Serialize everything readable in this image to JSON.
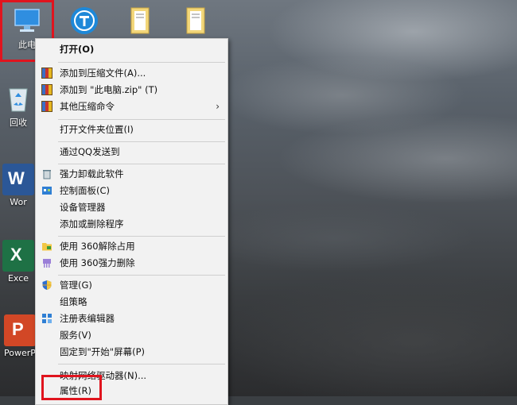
{
  "desktop": {
    "icons": [
      {
        "label": "此电",
        "name": "this-pc"
      },
      {
        "label": "回收",
        "name": "recycle-bin"
      },
      {
        "label": "Wor",
        "name": "word"
      },
      {
        "label": "Exce",
        "name": "excel"
      },
      {
        "label": "PowerP",
        "name": "powerpoint"
      }
    ],
    "colors": {
      "highlight": "#e0141e",
      "menu_bg": "#f2f2f2"
    }
  },
  "menu": {
    "open": "打开(O)",
    "add_archive": "添加到压缩文件(A)...",
    "add_zip": "添加到 \"此电脑.zip\" (T)",
    "other_compress": "其他压缩命令",
    "open_location": "打开文件夹位置(I)",
    "send_qq": "通过QQ发送到",
    "force_uninstall": "强力卸载此软件",
    "control_panel": "控制面板(C)",
    "device_manager": "设备管理器",
    "add_remove": "添加或删除程序",
    "unlock_360": "使用 360解除占用",
    "delete_360": "使用 360强力删除",
    "manage": "管理(G)",
    "group_policy": "组策略",
    "registry": "注册表编辑器",
    "services": "服务(V)",
    "pin_start": "固定到\"开始\"屏幕(P)",
    "map_drive": "映射网络驱动器(N)...",
    "properties": "属性(R)"
  }
}
